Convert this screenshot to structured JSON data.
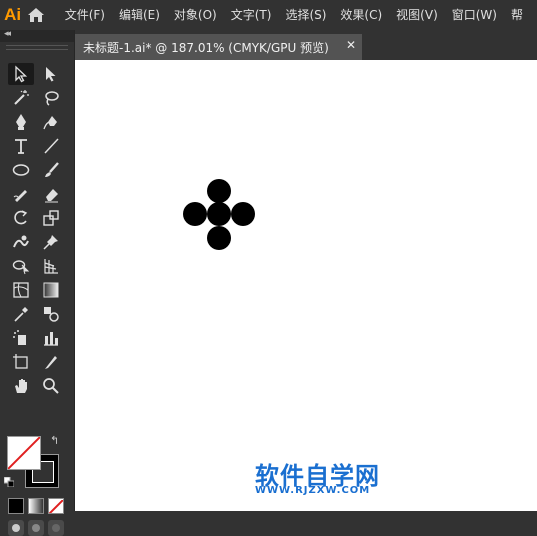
{
  "app": {
    "logo": "Ai"
  },
  "menu": {
    "items": [
      {
        "label": "文件(F)"
      },
      {
        "label": "编辑(E)"
      },
      {
        "label": "对象(O)"
      },
      {
        "label": "文字(T)"
      },
      {
        "label": "选择(S)"
      },
      {
        "label": "效果(C)"
      },
      {
        "label": "视图(V)"
      },
      {
        "label": "窗口(W)"
      },
      {
        "label": "帮"
      }
    ]
  },
  "toolbar": {
    "collapse": "◂◂",
    "tools": [
      "selection-tool",
      "direct-selection-tool",
      "magic-wand-tool",
      "lasso-tool",
      "pen-tool",
      "curvature-tool",
      "type-tool",
      "line-segment-tool",
      "ellipse-tool",
      "paintbrush-tool",
      "shaper-tool",
      "eraser-tool",
      "rotate-tool",
      "scale-tool",
      "warp-tool",
      "puppet-warp-tool",
      "shape-builder-tool",
      "perspective-grid-tool",
      "mesh-tool",
      "gradient-tool",
      "eyedropper-tool",
      "blend-tool",
      "symbol-sprayer-tool",
      "column-graph-tool",
      "artboard-tool",
      "slice-tool",
      "hand-tool",
      "zoom-tool"
    ],
    "swap_glyph": "↰"
  },
  "document": {
    "tab_title": "未标题-1.ai* @ 187.01% (CMYK/GPU 预览)",
    "close_glyph": "✕"
  },
  "watermark": {
    "text": "软件自学网",
    "url": "WWW.RJZXW.COM",
    "color": "#1a6fd0"
  },
  "colors": {
    "ui_dark": "#323232",
    "tab": "#535353",
    "logo": "#ff9a00",
    "canvas": "#ffffff",
    "shape_fill": "#000000"
  }
}
